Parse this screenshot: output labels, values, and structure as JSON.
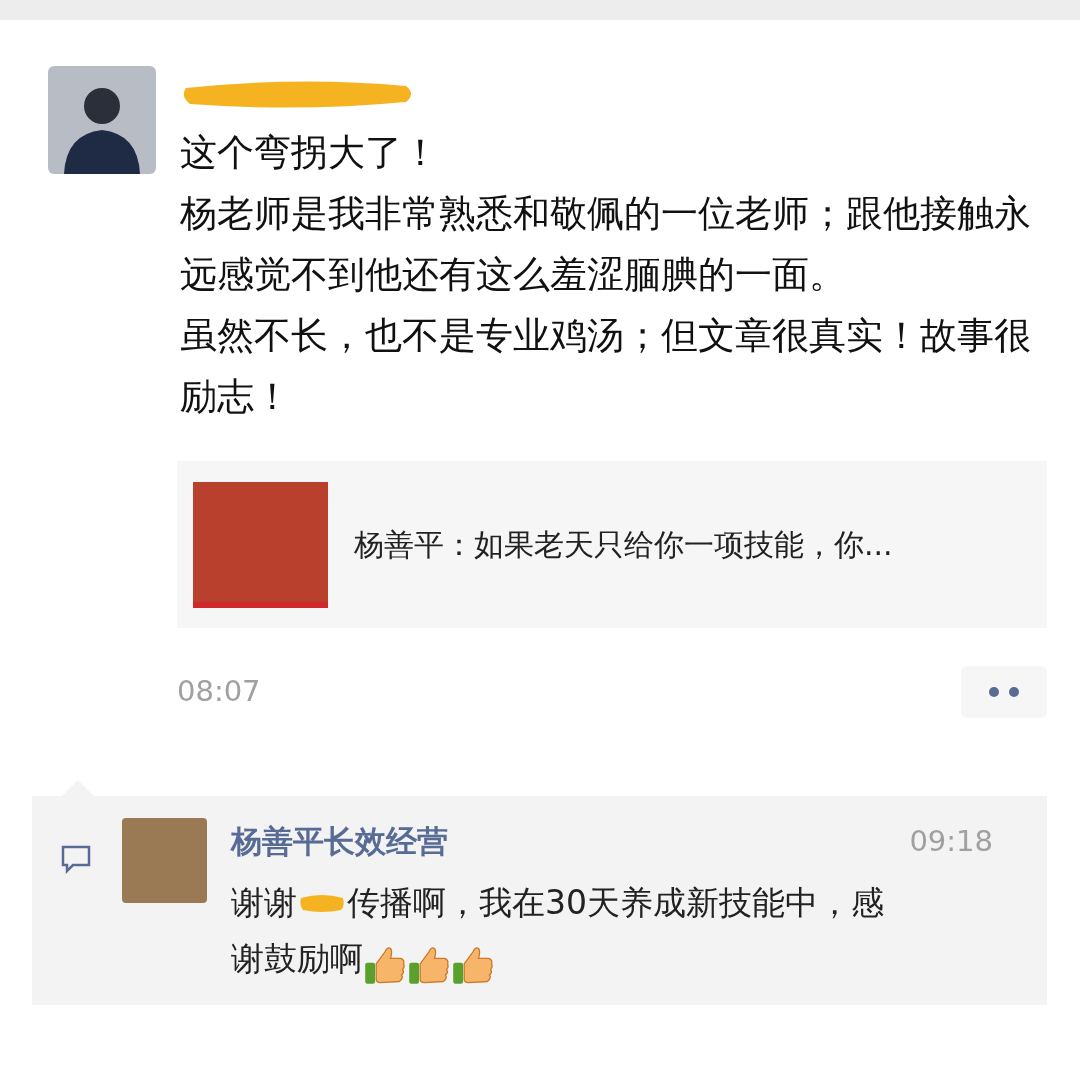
{
  "post": {
    "lines": [
      "这个弯拐大了！",
      "杨老师是我非常熟悉和敬佩的一位老师；跟他接触永远感觉不到他还有这么羞涩腼腆的一面。",
      "虽然不长，也不是专业鸡汤；但文章很真实！故事很励志！"
    ],
    "link": {
      "title": "杨善平：如果老天只给你一项技能，你..."
    },
    "time": "08:07"
  },
  "comments": [
    {
      "author": "杨善平长效经营",
      "time": "09:18",
      "before": "谢谢",
      "after": "传播啊，我在30天养成新技能中，感",
      "next_line": "谢鼓励啊",
      "emojis": [
        {
          "kind": "thumbs-up"
        },
        {
          "kind": "thumbs-up"
        },
        {
          "kind": "thumbs-up"
        }
      ]
    }
  ]
}
